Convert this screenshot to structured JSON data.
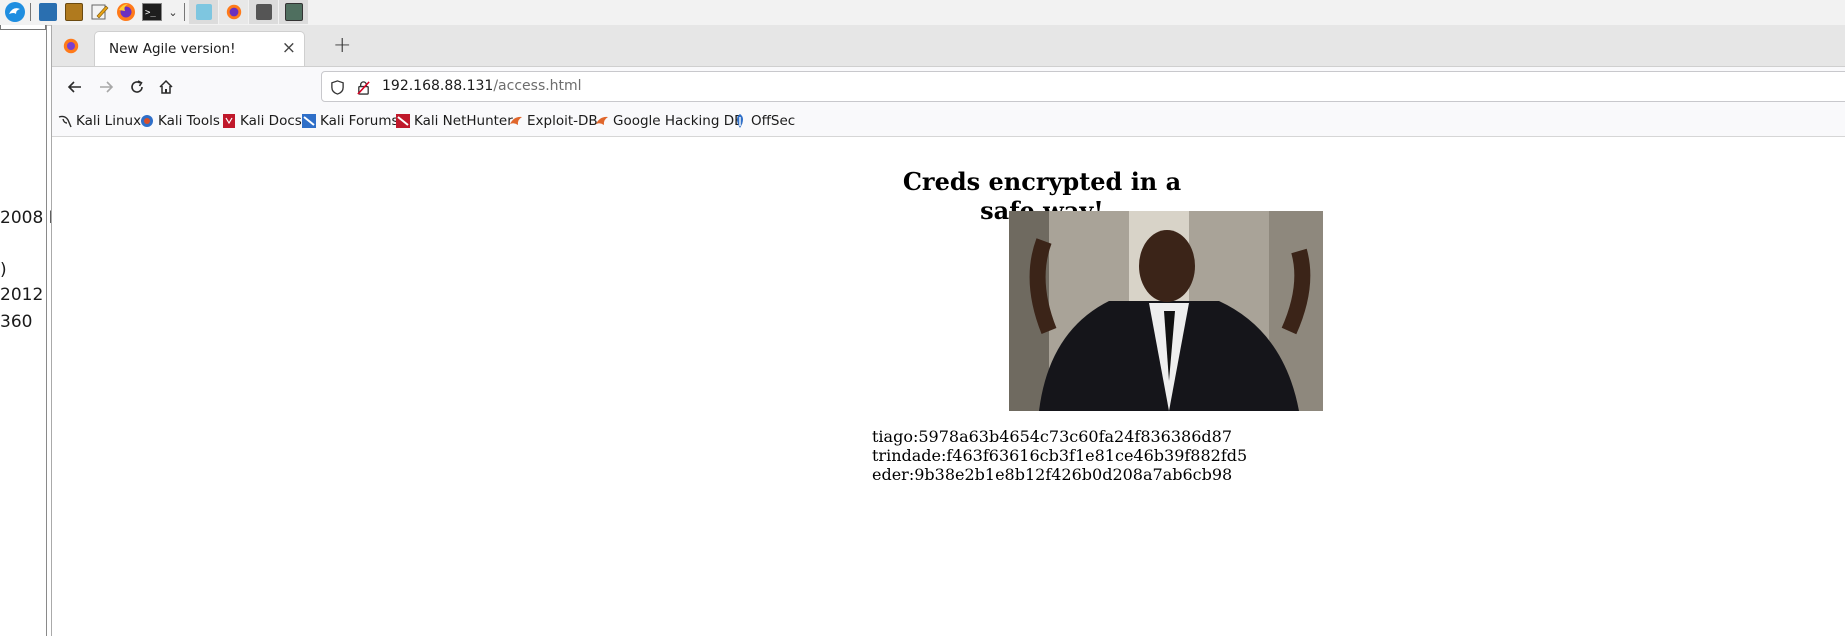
{
  "taskbar": {
    "icons": [
      "kali-dragon-icon",
      "files-icon",
      "archive-icon",
      "text-editor-icon",
      "firefox-icon",
      "terminal-icon",
      "chevron-down-icon",
      "workspace-1-icon",
      "firefox-task-icon",
      "terminal-task-icon",
      "network-task-icon"
    ]
  },
  "left_window": {
    "lines": [
      "2008 I",
      ")",
      "2012",
      "360"
    ]
  },
  "browser": {
    "tab": {
      "title": "New Agile version!",
      "close": "×"
    },
    "new_tab": "+",
    "address": {
      "host": "192.168.88.131",
      "path": "/access.html"
    },
    "bookmarks": [
      {
        "label": "Kali Linux",
        "color": "#2b2b2b"
      },
      {
        "label": "Kali Tools",
        "color": "#d84f2a"
      },
      {
        "label": "Kali Docs",
        "color": "#c0182b"
      },
      {
        "label": "Kali Forums",
        "color": "#2f6fc8"
      },
      {
        "label": "Kali NetHunter",
        "color": "#c0182b"
      },
      {
        "label": "Exploit-DB",
        "color": "#e0662b"
      },
      {
        "label": "Google Hacking DB",
        "color": "#e0662b"
      },
      {
        "label": "OffSec",
        "color": "#2f6fc8"
      }
    ]
  },
  "page": {
    "heading": "Creds encrypted in a safe way!",
    "credentials": [
      "tiago:5978a63b4654c73c60fa24f836386d87",
      "trindade:f463f63616cb3f1e81ce46b39f882fd5",
      "eder:9b38e2b1e8b12f426b0d208a7ab6cb98"
    ]
  }
}
